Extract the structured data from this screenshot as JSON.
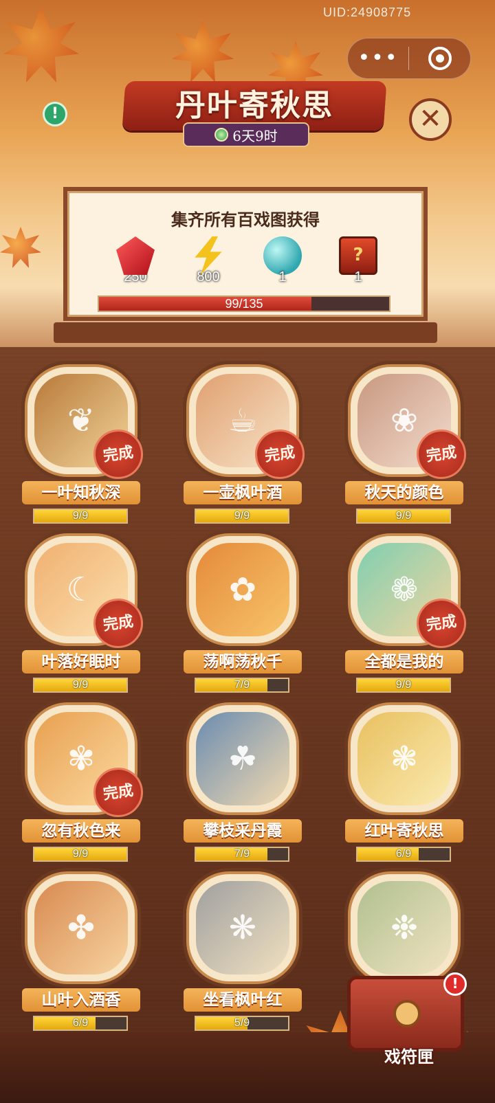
{
  "header": {
    "uid": "UID:24908775",
    "more_label": "•••",
    "title": "丹叶寄秋思",
    "timer": "6天9时",
    "info_label": "!",
    "close_label": "✕"
  },
  "rewards_panel": {
    "title": "集齐所有百戏图获得",
    "rewards": [
      {
        "icon": "ruby-gem-icon",
        "count": "250"
      },
      {
        "icon": "lightning-icon",
        "count": "800"
      },
      {
        "icon": "magnifier-orb-icon",
        "count": "1"
      },
      {
        "icon": "mystery-chest-icon",
        "count": "1"
      }
    ],
    "progress_text": "99/135",
    "progress_fraction": 0.733
  },
  "cards": [
    {
      "name": "一叶知秋深",
      "progress": "9/9",
      "fraction": 1.0,
      "done": true,
      "icon": "book-icon",
      "done_label": "完成"
    },
    {
      "name": "一壶枫叶酒",
      "progress": "9/9",
      "fraction": 1.0,
      "done": true,
      "icon": "teapot-icon",
      "done_label": "完成"
    },
    {
      "name": "秋天的颜色",
      "progress": "9/9",
      "fraction": 1.0,
      "done": true,
      "icon": "lady-portrait-icon",
      "done_label": "完成"
    },
    {
      "name": "叶落好眠时",
      "progress": "9/9",
      "fraction": 1.0,
      "done": true,
      "icon": "sleeping-cat-icon",
      "done_label": "完成"
    },
    {
      "name": "荡啊荡秋千",
      "progress": "7/9",
      "fraction": 0.778,
      "done": false,
      "icon": "swing-cat-icon",
      "done_label": ""
    },
    {
      "name": "全都是我的",
      "progress": "9/9",
      "fraction": 1.0,
      "done": true,
      "icon": "dragon-pet-icon",
      "done_label": "完成"
    },
    {
      "name": "忽有秋色来",
      "progress": "9/9",
      "fraction": 1.0,
      "done": true,
      "icon": "dancing-girl-icon",
      "done_label": "完成"
    },
    {
      "name": "攀枝采丹霞",
      "progress": "7/9",
      "fraction": 0.778,
      "done": false,
      "icon": "straw-hat-man-icon",
      "done_label": ""
    },
    {
      "name": "红叶寄秋思",
      "progress": "6/9",
      "fraction": 0.667,
      "done": false,
      "icon": "yellow-robe-lady-icon",
      "done_label": ""
    },
    {
      "name": "山叶入酒香",
      "progress": "6/9",
      "fraction": 0.667,
      "done": false,
      "icon": "noble-lady-icon",
      "done_label": ""
    },
    {
      "name": "坐看枫叶红",
      "progress": "5/9",
      "fraction": 0.556,
      "done": false,
      "icon": "silver-hair-man-icon",
      "done_label": ""
    },
    {
      "name": "",
      "progress": "",
      "fraction": 0,
      "done": false,
      "icon": "two-ladies-icon",
      "done_label": ""
    }
  ],
  "chest": {
    "label": "戏符匣",
    "alert": "!"
  },
  "colors": {
    "accent_red": "#c23a22",
    "progress_yellow": "#ffd63a",
    "done_stamp": "#d8452f"
  }
}
